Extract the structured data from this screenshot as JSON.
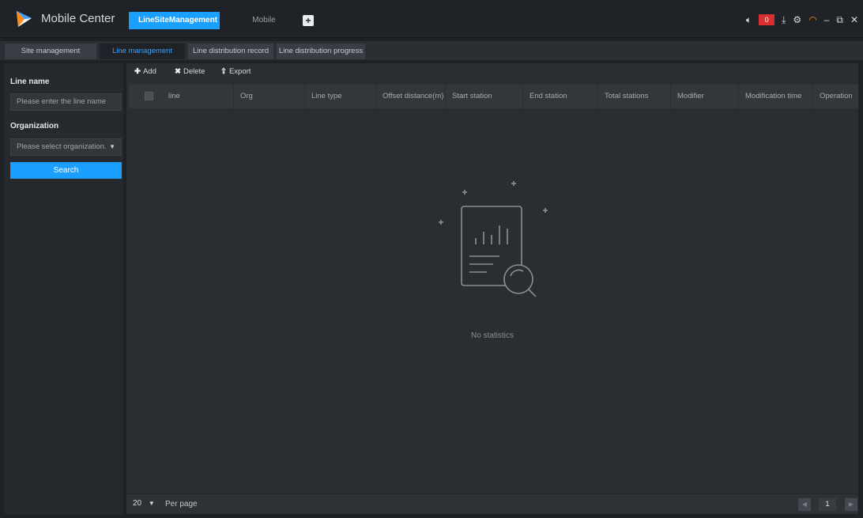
{
  "app": {
    "title": "Mobile Center",
    "logo_icon": "app-logo-icon"
  },
  "top_tabs": [
    {
      "label": "LineSiteManagement",
      "active": true
    },
    {
      "label": "Mobile",
      "active": false
    }
  ],
  "system": {
    "alarm_count": "0",
    "accent": "#1a9fff",
    "alarm_color": "#d92f2f"
  },
  "sub_tabs": [
    {
      "label": "Site management",
      "active": false
    },
    {
      "label": "Line management",
      "active": true
    },
    {
      "label": "Line distribution record",
      "active": false
    },
    {
      "label": "Line distribution progress",
      "active": false
    }
  ],
  "filters": {
    "line_name_label": "Line name",
    "line_name_placeholder": "Please enter the line name",
    "organization_label": "Organization",
    "organization_placeholder": "Please select organization.",
    "search_label": "Search"
  },
  "toolbar": {
    "add": "Add",
    "delete": "Delete",
    "export": "Export"
  },
  "table": {
    "columns": [
      "line",
      "Org",
      "Line type",
      "Offset distance(m)",
      "Start station",
      "End station",
      "Total stations",
      "Modifier",
      "Modification time",
      "Operation"
    ],
    "rows": []
  },
  "empty_state": {
    "text": "No statistics"
  },
  "pagination": {
    "per_page_value": "20",
    "per_page_label": "Per page",
    "current_page": "1"
  }
}
